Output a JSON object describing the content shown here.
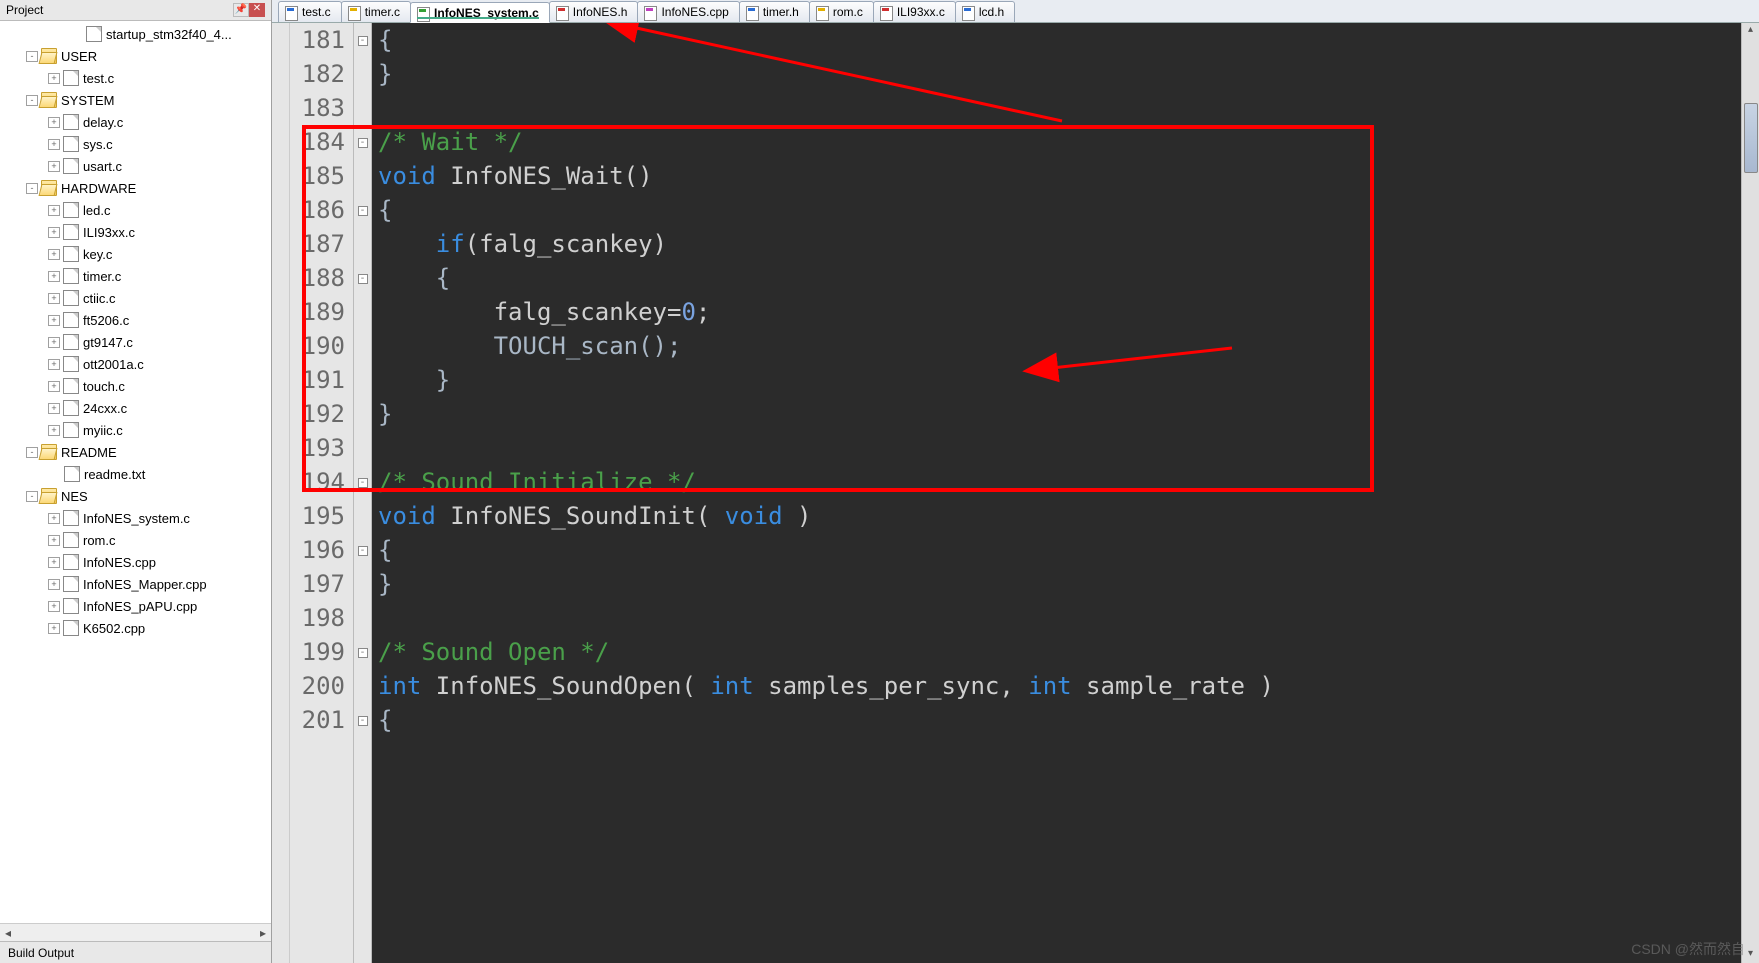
{
  "panel": {
    "title": "Project",
    "build": "Build Output"
  },
  "tree": [
    {
      "d": 3,
      "t": "f",
      "e": "",
      "n": "startup_stm32f40_4..."
    },
    {
      "d": 1,
      "t": "d",
      "e": "-",
      "n": "USER"
    },
    {
      "d": 2,
      "t": "f",
      "e": "+",
      "n": "test.c"
    },
    {
      "d": 1,
      "t": "d",
      "e": "-",
      "n": "SYSTEM"
    },
    {
      "d": 2,
      "t": "f",
      "e": "+",
      "n": "delay.c"
    },
    {
      "d": 2,
      "t": "f",
      "e": "+",
      "n": "sys.c"
    },
    {
      "d": 2,
      "t": "f",
      "e": "+",
      "n": "usart.c"
    },
    {
      "d": 1,
      "t": "d",
      "e": "-",
      "n": "HARDWARE"
    },
    {
      "d": 2,
      "t": "f",
      "e": "+",
      "n": "led.c"
    },
    {
      "d": 2,
      "t": "f",
      "e": "+",
      "n": "ILI93xx.c"
    },
    {
      "d": 2,
      "t": "f",
      "e": "+",
      "n": "key.c"
    },
    {
      "d": 2,
      "t": "f",
      "e": "+",
      "n": "timer.c"
    },
    {
      "d": 2,
      "t": "f",
      "e": "+",
      "n": "ctiic.c"
    },
    {
      "d": 2,
      "t": "f",
      "e": "+",
      "n": "ft5206.c"
    },
    {
      "d": 2,
      "t": "f",
      "e": "+",
      "n": "gt9147.c"
    },
    {
      "d": 2,
      "t": "f",
      "e": "+",
      "n": "ott2001a.c"
    },
    {
      "d": 2,
      "t": "f",
      "e": "+",
      "n": "touch.c"
    },
    {
      "d": 2,
      "t": "f",
      "e": "+",
      "n": "24cxx.c"
    },
    {
      "d": 2,
      "t": "f",
      "e": "+",
      "n": "myiic.c"
    },
    {
      "d": 1,
      "t": "d",
      "e": "-",
      "n": "README"
    },
    {
      "d": 2,
      "t": "f",
      "e": "",
      "n": "readme.txt"
    },
    {
      "d": 1,
      "t": "d",
      "e": "-",
      "n": "NES"
    },
    {
      "d": 2,
      "t": "f",
      "e": "+",
      "n": "InfoNES_system.c"
    },
    {
      "d": 2,
      "t": "f",
      "e": "+",
      "n": "rom.c"
    },
    {
      "d": 2,
      "t": "f",
      "e": "+",
      "n": "InfoNES.cpp"
    },
    {
      "d": 2,
      "t": "f",
      "e": "+",
      "n": "InfoNES_Mapper.cpp"
    },
    {
      "d": 2,
      "t": "f",
      "e": "+",
      "n": "InfoNES_pAPU.cpp"
    },
    {
      "d": 2,
      "t": "f",
      "e": "+",
      "n": "K6502.cpp"
    }
  ],
  "tabs": [
    {
      "n": "test.c",
      "c": "c-blue"
    },
    {
      "n": "timer.c",
      "c": "c-yel"
    },
    {
      "n": "InfoNES_system.c",
      "c": "c-grn",
      "active": true
    },
    {
      "n": "InfoNES.h",
      "c": "c-red"
    },
    {
      "n": "InfoNES.cpp",
      "c": "c-cpp"
    },
    {
      "n": "timer.h",
      "c": "c-blue"
    },
    {
      "n": "rom.c",
      "c": "c-yel"
    },
    {
      "n": "ILI93xx.c",
      "c": "c-red"
    },
    {
      "n": "lcd.h",
      "c": "c-blue"
    }
  ],
  "lineStart": 181,
  "lines": [
    {
      "raw": "{",
      "f": "-"
    },
    {
      "raw": "}"
    },
    {
      "raw": ""
    },
    {
      "seg": [
        [
          "cm",
          "/* Wait */"
        ]
      ],
      "f": "-"
    },
    {
      "seg": [
        [
          "kw",
          "void"
        ],
        [
          "id",
          " InfoNES_Wait()"
        ]
      ]
    },
    {
      "raw": "{",
      "f": "-"
    },
    {
      "seg": [
        [
          "id",
          "    "
        ],
        [
          "kw",
          "if"
        ],
        [
          "id",
          "(falg_scankey)"
        ]
      ]
    },
    {
      "raw": "    {",
      "f": "-"
    },
    {
      "seg": [
        [
          "id",
          "        falg_scankey="
        ],
        [
          "num",
          "0"
        ],
        [
          "id",
          ";"
        ]
      ]
    },
    {
      "raw": "        TOUCH_scan();"
    },
    {
      "raw": "    }"
    },
    {
      "raw": "}"
    },
    {
      "raw": ""
    },
    {
      "seg": [
        [
          "cm",
          "/* Sound Initialize */"
        ]
      ],
      "f": "-"
    },
    {
      "seg": [
        [
          "kw",
          "void"
        ],
        [
          "id",
          " InfoNES_SoundInit( "
        ],
        [
          "kw",
          "void"
        ],
        [
          "id",
          " )"
        ]
      ]
    },
    {
      "raw": "{",
      "f": "-"
    },
    {
      "raw": "}"
    },
    {
      "raw": ""
    },
    {
      "seg": [
        [
          "cm",
          "/* Sound Open */"
        ]
      ],
      "f": "-"
    },
    {
      "seg": [
        [
          "kw",
          "int"
        ],
        [
          "id",
          " InfoNES_SoundOpen( "
        ],
        [
          "kw",
          "int"
        ],
        [
          "id",
          " samples_per_sync, "
        ],
        [
          "kw",
          "int"
        ],
        [
          "id",
          " sample_rate )"
        ]
      ]
    },
    {
      "raw": "{",
      "f": "-"
    }
  ],
  "watermark": "CSDN @然而然自"
}
